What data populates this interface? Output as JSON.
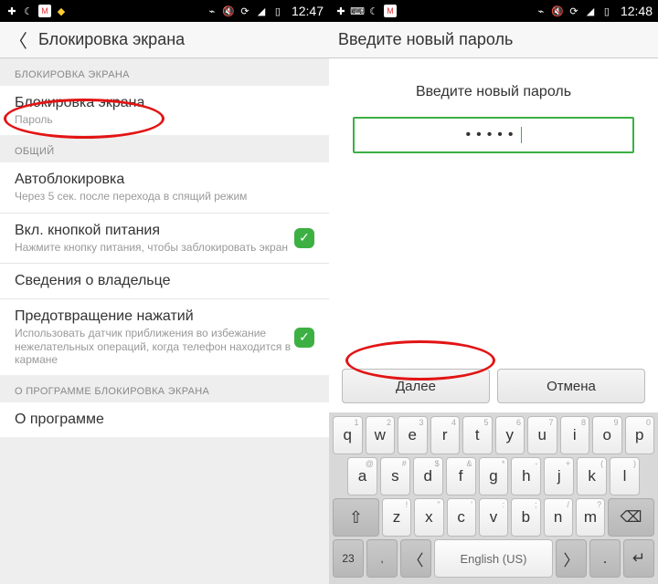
{
  "status": {
    "time_left": "12:47",
    "time_right": "12:48"
  },
  "left": {
    "header": "Блокировка экрана",
    "sec1": "БЛОКИРОВКА ЭКРАНА",
    "item_lock_title": "Блокировка экрана",
    "item_lock_sub": "Пароль",
    "sec2": "ОБЩИЙ",
    "item_auto_title": "Автоблокировка",
    "item_auto_sub": "Через 5 сек. после перехода в спящий режим",
    "item_pwr_title": "Вкл. кнопкой питания",
    "item_pwr_sub": "Нажмите кнопку питания, чтобы заблокировать экран",
    "item_owner_title": "Сведения о владельце",
    "item_owner_sub": "",
    "item_touch_title": "Предотвращение нажатий",
    "item_touch_sub": "Использовать датчик приближения во избежание нежелательных операций, когда телефон находится в кармане",
    "sec3": "О ПРОГРАММЕ БЛОКИРОВКА ЭКРАНА",
    "item_about_title": "О программе"
  },
  "right": {
    "header": "Введите новый пароль",
    "prompt": "Введите новый пароль",
    "pw_dots": "•••••",
    "next": "Далее",
    "cancel": "Отмена",
    "space_label": "English (US)",
    "krow1": [
      "q",
      "w",
      "e",
      "r",
      "t",
      "y",
      "u",
      "i",
      "o",
      "p"
    ],
    "krow1_alt": [
      "1",
      "2",
      "3",
      "4",
      "5",
      "6",
      "7",
      "8",
      "9",
      "0"
    ],
    "krow2": [
      "a",
      "s",
      "d",
      "f",
      "g",
      "h",
      "j",
      "k",
      "l"
    ],
    "krow2_alt": [
      "@",
      "#",
      "$",
      "&",
      "*",
      "-",
      "+",
      "(",
      ")"
    ],
    "krow3": [
      "z",
      "x",
      "c",
      "v",
      "b",
      "n",
      "m"
    ],
    "krow3_alt": [
      "!",
      "\"",
      "'",
      ":",
      ";",
      "/",
      "?"
    ]
  }
}
